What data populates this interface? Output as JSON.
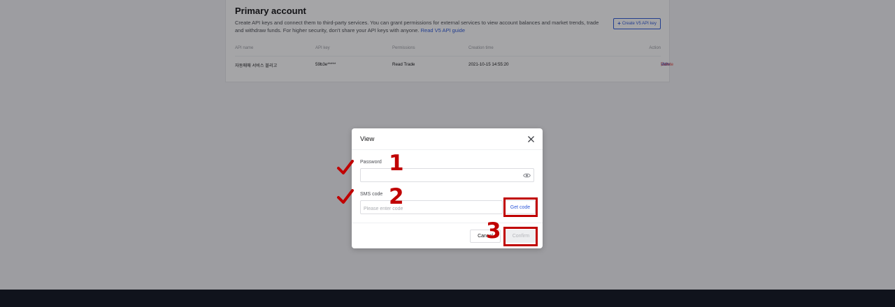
{
  "account": {
    "title": "Primary account",
    "description": "Create API keys and connect them to third-party services. You can grant permissions for external services to view account balances and market trends, trade and withdraw funds. For higher security, don't share your API keys with anyone.",
    "guide_link": "Read V5 API guide",
    "create_button": "Create V5 API key"
  },
  "table": {
    "headers": [
      "API name",
      "API key",
      "Permissions",
      "Creation time",
      "Action"
    ],
    "rows": [
      {
        "name": "자동매매 서비스 블리고",
        "key": "59b3e*****",
        "permissions": "Read Trade",
        "created": "2021-10-15 14:55:20",
        "actions": [
          "View",
          "Edit",
          "Delete"
        ]
      }
    ]
  },
  "modal": {
    "title": "View",
    "password_label": "Password",
    "password_value": "",
    "sms_label": "SMS code",
    "sms_placeholder": "Please enter code",
    "sms_value": "",
    "get_code": "Get code",
    "cancel": "Cancel",
    "confirm": "Confirm"
  },
  "annotations": {
    "steps": [
      "1",
      "2",
      "3"
    ],
    "color": "#c00000"
  },
  "colors": {
    "accent": "#2e59d9",
    "danger": "#e0403b",
    "footer": "#10131c"
  }
}
